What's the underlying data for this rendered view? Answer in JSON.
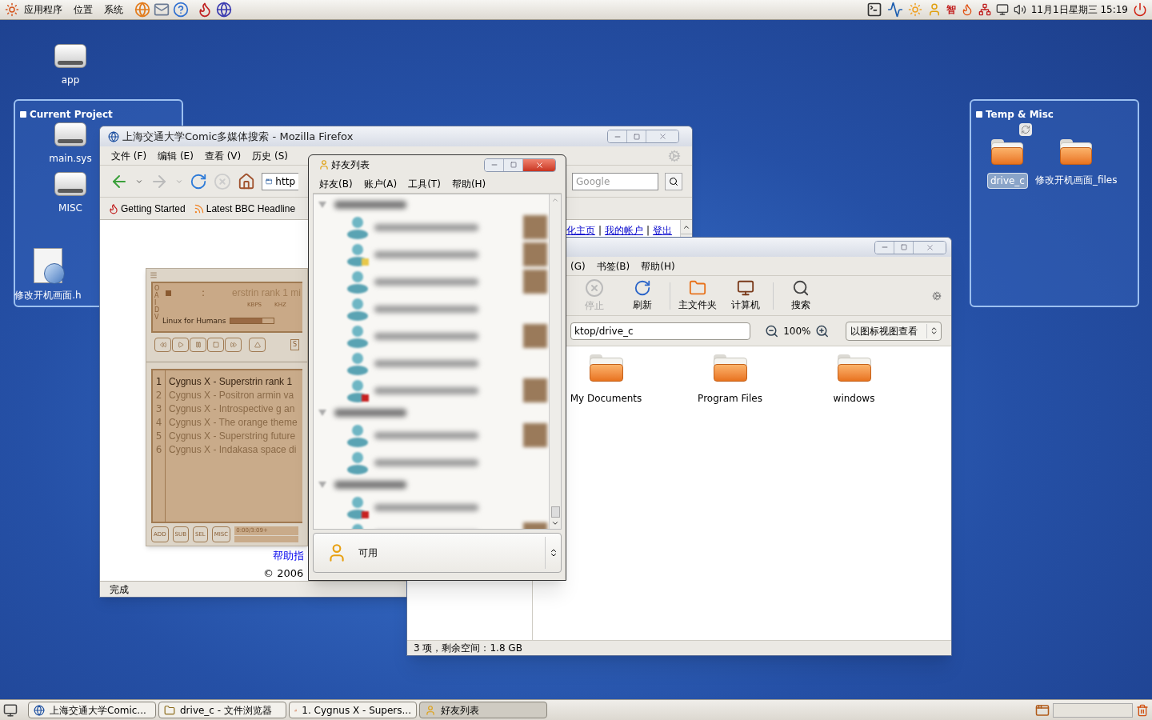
{
  "top_panel": {
    "menus": [
      "应用程序",
      "位置",
      "系统"
    ],
    "ime_indicator": "智",
    "clock": "11月1日星期三 15:19"
  },
  "desktop": {
    "icons": [
      {
        "label": "app",
        "kind": "drive"
      },
      {
        "label": "main.sys",
        "kind": "drive"
      },
      {
        "label": "MISC",
        "kind": "drive"
      },
      {
        "label": "修改开机画面.h",
        "kind": "image"
      }
    ],
    "panels": [
      {
        "title": "Current Project"
      },
      {
        "title": "Temp & Misc",
        "items": [
          {
            "label": "drive_c",
            "selected": true
          },
          {
            "label": "修改开机画面_files",
            "selected": false
          }
        ]
      }
    ]
  },
  "firefox": {
    "title": "上海交通大学Comic多媒体搜索 - Mozilla Firefox",
    "active": false,
    "menus": [
      "文件 (F)",
      "编辑 (E)",
      "查看 (V)",
      "历史 (S)"
    ],
    "url": "http",
    "search_placeholder": "Google",
    "bookmarks": [
      "Getting Started",
      "Latest BBC Headline"
    ],
    "links": [
      {
        "kind": "link",
        "text": "化主页"
      },
      {
        "kind": "separator",
        "text": "|"
      },
      {
        "kind": "link",
        "text": "我的帐户"
      },
      {
        "kind": "separator",
        "text": "|"
      },
      {
        "kind": "link",
        "text": "登出"
      }
    ],
    "footer_link": "帮助指",
    "copyright": "© 2006",
    "status": "完成"
  },
  "media_player": {
    "display_letters": "OAIDV",
    "time_separator": ":",
    "scroll_text": "erstrin rank 1 mi",
    "units": [
      "KBPS",
      "KHZ"
    ],
    "song": "Linux for Humans",
    "level": 0.75,
    "shuffle": "S",
    "playlist": [
      {
        "number": "1",
        "artist": "Cygnus X",
        "title": "- Superstrin rank 1",
        "selected": true
      },
      {
        "number": "2",
        "artist": "Cygnus X",
        "title": "- Positron armin va",
        "selected": false
      },
      {
        "number": "3",
        "artist": "Cygnus X",
        "title": "- Introspective g an",
        "selected": false
      },
      {
        "number": "4",
        "artist": "Cygnus X",
        "title": "- The orange theme",
        "selected": false
      },
      {
        "number": "5",
        "artist": "Cygnus X",
        "title": "- Superstring future",
        "selected": false
      },
      {
        "number": "6",
        "artist": "Cygnus X",
        "title": "- Indakasa space di",
        "selected": false
      }
    ],
    "buttons": [
      "ADD",
      "SUB",
      "SEL",
      "MISC"
    ],
    "time": "0:00/3:09+"
  },
  "buddy_list": {
    "title": "好友列表",
    "active": true,
    "menus": [
      "好友(B)",
      "账户(A)",
      "工具(T)",
      "帮助(H)"
    ],
    "groups": [
      {
        "expanded": true,
        "contacts": [
          {
            "away": false,
            "busy": false,
            "avatar": true
          },
          {
            "away": true,
            "busy": false,
            "avatar": true
          },
          {
            "away": false,
            "busy": false,
            "avatar": true
          },
          {
            "away": false,
            "busy": false,
            "avatar": false
          },
          {
            "away": false,
            "busy": false,
            "avatar": true
          },
          {
            "away": false,
            "busy": false,
            "avatar": false
          },
          {
            "away": false,
            "busy": true,
            "avatar": true
          }
        ]
      },
      {
        "expanded": true,
        "contacts": [
          {
            "away": false,
            "busy": false,
            "avatar": true
          },
          {
            "away": false,
            "busy": false,
            "avatar": false
          }
        ]
      },
      {
        "expanded": true,
        "contacts": [
          {
            "away": false,
            "busy": true,
            "avatar": false
          },
          {
            "away": false,
            "busy": false,
            "avatar": true
          }
        ]
      }
    ],
    "status": "可用"
  },
  "file_manager": {
    "active": false,
    "menus": [
      "(G)",
      "书签(B)",
      "帮助(H)"
    ],
    "toolbar": [
      [
        {
          "label": "停止",
          "disabled": true
        },
        {
          "label": "刷新",
          "disabled": false
        }
      ],
      [
        {
          "label": "主文件夹",
          "disabled": false
        },
        {
          "label": "计算机",
          "disabled": false
        }
      ],
      [
        {
          "label": "搜索",
          "disabled": false
        }
      ]
    ],
    "location": "ktop/drive_c",
    "zoom": "100%",
    "view": "以图标视图查看",
    "items": [
      "My Documents",
      "Program Files",
      "windows"
    ],
    "status": "3 项，剩余空间：1.8 GB"
  },
  "taskbar": {
    "tasks": [
      {
        "label": "上海交通大学Comic...",
        "selected": false
      },
      {
        "label": "drive_c - 文件浏览器",
        "selected": false
      },
      {
        "label": "1. Cygnus X - Supers...",
        "selected": false
      },
      {
        "label": "好友列表",
        "selected": true
      }
    ]
  }
}
